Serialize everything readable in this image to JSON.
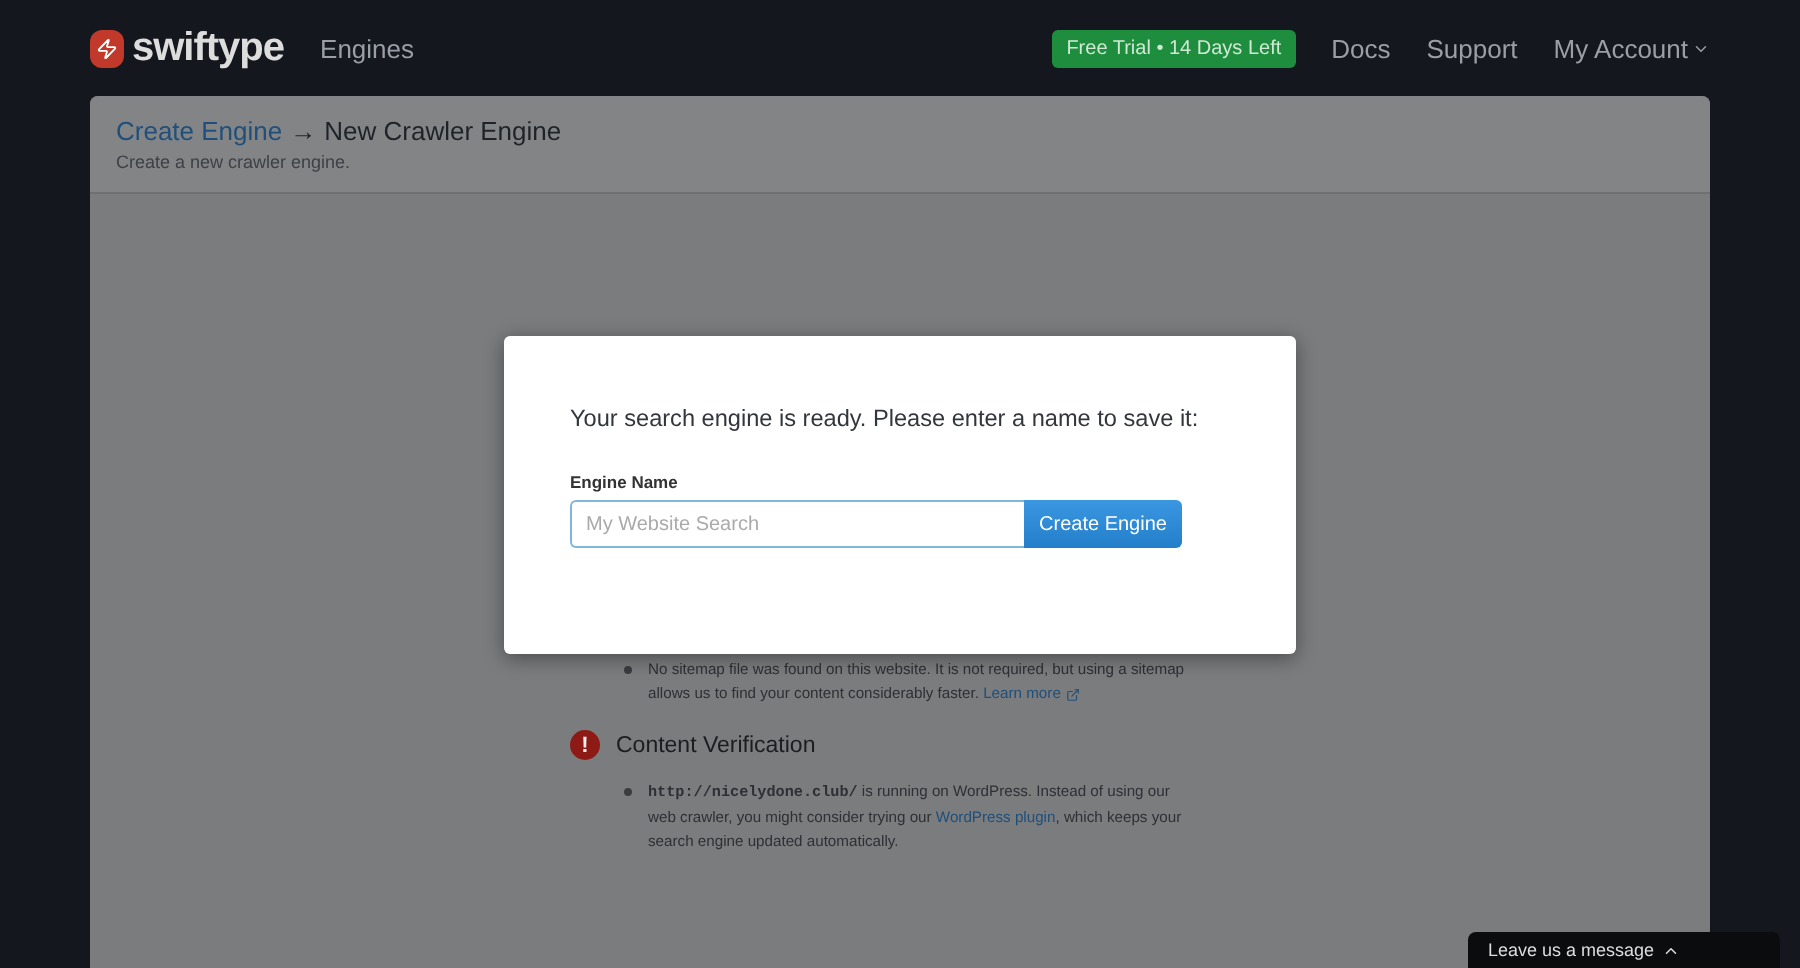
{
  "nav": {
    "brand": "swiftype",
    "links": [
      {
        "label": "Engines"
      }
    ],
    "trial_badge": "Free Trial • 14 Days Left",
    "right_links": [
      {
        "label": "Docs",
        "kind": "link"
      },
      {
        "label": "Support",
        "kind": "link"
      },
      {
        "label": "My Account",
        "kind": "dropdown"
      }
    ]
  },
  "page_header": {
    "breadcrumb_link": "Create Engine",
    "arrow": "→",
    "title": "New Crawler Engine",
    "subtitle": "Create a new crawler engine."
  },
  "checks": [
    {
      "items": [
        {
          "parts": [
            {
              "kind": "text",
              "text": "No sitemap file was found on this website. It is not required, but using a sitemap allows us to find your content considerably faster. "
            },
            {
              "kind": "external_link",
              "text": "Learn more"
            }
          ]
        }
      ]
    },
    {
      "heading": "Content Verification",
      "alert_icon": "!",
      "items": [
        {
          "parts": [
            {
              "kind": "code",
              "text": "http://nicelydone.club/"
            },
            {
              "kind": "text",
              "text": " is running on WordPress. Instead of using our web crawler, you might consider trying our "
            },
            {
              "kind": "link",
              "text": "WordPress plugin"
            },
            {
              "kind": "text",
              "text": ", which keeps your search engine updated automatically."
            }
          ]
        }
      ]
    }
  ],
  "modal": {
    "prompt": "Your search engine is ready. Please enter a name to save it:",
    "field_label": "Engine Name",
    "placeholder": "My Website Search",
    "button": "Create Engine"
  },
  "chat_tab": {
    "label": "Leave us a message"
  }
}
